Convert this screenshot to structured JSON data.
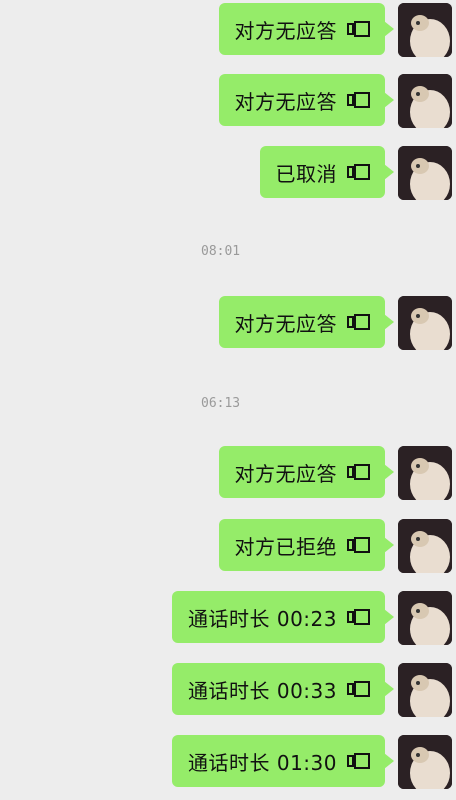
{
  "messages": [
    {
      "text": "对方无应答",
      "icon": "video-call-icon"
    },
    {
      "text": "对方无应答",
      "icon": "video-call-icon"
    },
    {
      "text": "已取消",
      "icon": "video-call-icon"
    },
    {
      "time": "08:01"
    },
    {
      "text": "对方无应答",
      "icon": "video-call-icon"
    },
    {
      "time": "06:13"
    },
    {
      "text": "对方无应答",
      "icon": "video-call-icon"
    },
    {
      "text": "对方已拒绝",
      "icon": "video-call-icon"
    },
    {
      "text": "通话时长 00:23",
      "icon": "video-call-icon"
    },
    {
      "text": "通话时长 00:33",
      "icon": "video-call-icon"
    },
    {
      "text": "通话时长 01:30",
      "icon": "video-call-icon"
    }
  ],
  "colors": {
    "background": "#ededed",
    "bubble": "#95ec69",
    "timestamp": "#9a9a9a"
  }
}
